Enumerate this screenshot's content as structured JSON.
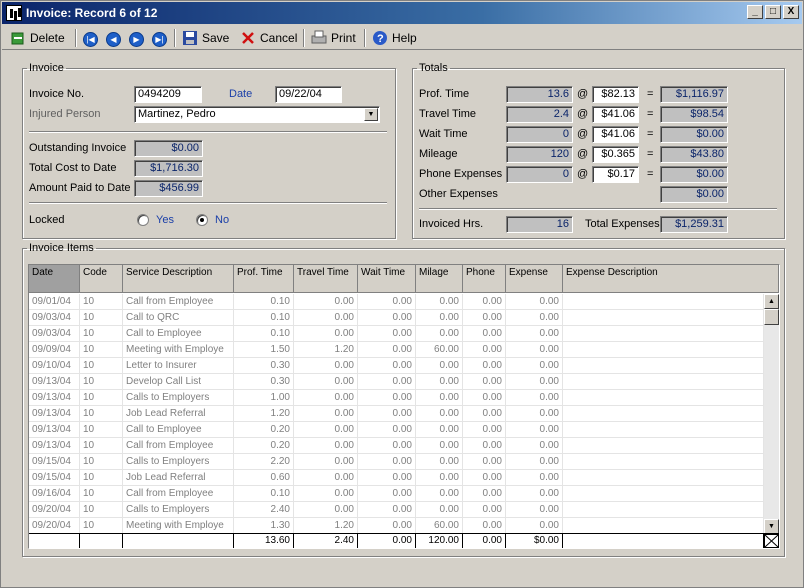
{
  "window": {
    "title": "Invoice: Record 6 of 12",
    "min": "_",
    "max": "□",
    "close": "X"
  },
  "toolbar": {
    "delete": "Delete",
    "save": "Save",
    "cancel": "Cancel",
    "print": "Print",
    "help": "Help"
  },
  "invoice": {
    "legend": "Invoice",
    "no_label": "Invoice No.",
    "no": "0494209",
    "date_label": "Date",
    "date": "09/22/04",
    "injured_label": "Injured Person",
    "injured": "Martinez, Pedro",
    "outstanding_label": "Outstanding Invoice",
    "outstanding": "$0.00",
    "total_cost_label": "Total Cost to Date",
    "total_cost": "$1,716.30",
    "amount_paid_label": "Amount Paid to Date",
    "amount_paid": "$456.99",
    "locked_label": "Locked",
    "yes": "Yes",
    "no_opt": "No",
    "locked": "No"
  },
  "totals": {
    "legend": "Totals",
    "rows": [
      {
        "label": "Prof. Time",
        "qty": "13.6",
        "at": "@",
        "rate": "$82.13",
        "eq": "=",
        "amount": "$1,116.97"
      },
      {
        "label": "Travel Time",
        "qty": "2.4",
        "at": "@",
        "rate": "$41.06",
        "eq": "=",
        "amount": "$98.54"
      },
      {
        "label": "Wait Time",
        "qty": "0",
        "at": "@",
        "rate": "$41.06",
        "eq": "=",
        "amount": "$0.00"
      },
      {
        "label": "Mileage",
        "qty": "120",
        "at": "@",
        "rate": "$0.365",
        "eq": "=",
        "amount": "$43.80"
      },
      {
        "label": "Phone Expenses",
        "qty": "0",
        "at": "@",
        "rate": "$0.17",
        "eq": "=",
        "amount": "$0.00"
      }
    ],
    "other_label": "Other Expenses",
    "other": "$0.00",
    "invoiced_label": "Invoiced Hrs.",
    "invoiced": "16",
    "total_exp_label": "Total Expenses",
    "total_exp": "$1,259.31"
  },
  "items": {
    "legend": "Invoice Items",
    "headers": [
      "Date",
      "Code",
      "Service Description",
      "Prof. Time",
      "Travel Time",
      "Wait Time",
      "Milage",
      "Phone",
      "Expense",
      "Expense Description"
    ],
    "rows": [
      [
        "09/01/04",
        "10",
        "Call from Employee",
        "0.10",
        "0.00",
        "0.00",
        "0.00",
        "0.00",
        "0.00"
      ],
      [
        "09/03/04",
        "10",
        "Call to QRC",
        "0.10",
        "0.00",
        "0.00",
        "0.00",
        "0.00",
        "0.00"
      ],
      [
        "09/03/04",
        "10",
        "Call to Employee",
        "0.10",
        "0.00",
        "0.00",
        "0.00",
        "0.00",
        "0.00"
      ],
      [
        "09/09/04",
        "10",
        "Meeting with Employe",
        "1.50",
        "1.20",
        "0.00",
        "60.00",
        "0.00",
        "0.00"
      ],
      [
        "09/10/04",
        "10",
        "Letter to Insurer",
        "0.30",
        "0.00",
        "0.00",
        "0.00",
        "0.00",
        "0.00"
      ],
      [
        "09/13/04",
        "10",
        "Develop Call List",
        "0.30",
        "0.00",
        "0.00",
        "0.00",
        "0.00",
        "0.00"
      ],
      [
        "09/13/04",
        "10",
        "Calls to Employers",
        "1.00",
        "0.00",
        "0.00",
        "0.00",
        "0.00",
        "0.00"
      ],
      [
        "09/13/04",
        "10",
        "Job Lead Referral",
        "1.20",
        "0.00",
        "0.00",
        "0.00",
        "0.00",
        "0.00"
      ],
      [
        "09/13/04",
        "10",
        "Call to Employee",
        "0.20",
        "0.00",
        "0.00",
        "0.00",
        "0.00",
        "0.00"
      ],
      [
        "09/13/04",
        "10",
        "Call from Employee",
        "0.20",
        "0.00",
        "0.00",
        "0.00",
        "0.00",
        "0.00"
      ],
      [
        "09/15/04",
        "10",
        "Calls to Employers",
        "2.20",
        "0.00",
        "0.00",
        "0.00",
        "0.00",
        "0.00"
      ],
      [
        "09/15/04",
        "10",
        "Job Lead Referral",
        "0.60",
        "0.00",
        "0.00",
        "0.00",
        "0.00",
        "0.00"
      ],
      [
        "09/16/04",
        "10",
        "Call from Employee",
        "0.10",
        "0.00",
        "0.00",
        "0.00",
        "0.00",
        "0.00"
      ],
      [
        "09/20/04",
        "10",
        "Calls to Employers",
        "2.40",
        "0.00",
        "0.00",
        "0.00",
        "0.00",
        "0.00"
      ],
      [
        "09/20/04",
        "10",
        "Meeting with Employe",
        "1.30",
        "1.20",
        "0.00",
        "60.00",
        "0.00",
        "0.00"
      ]
    ],
    "footer": [
      "13.60",
      "2.40",
      "0.00",
      "120.00",
      "0.00",
      "$0.00"
    ]
  }
}
